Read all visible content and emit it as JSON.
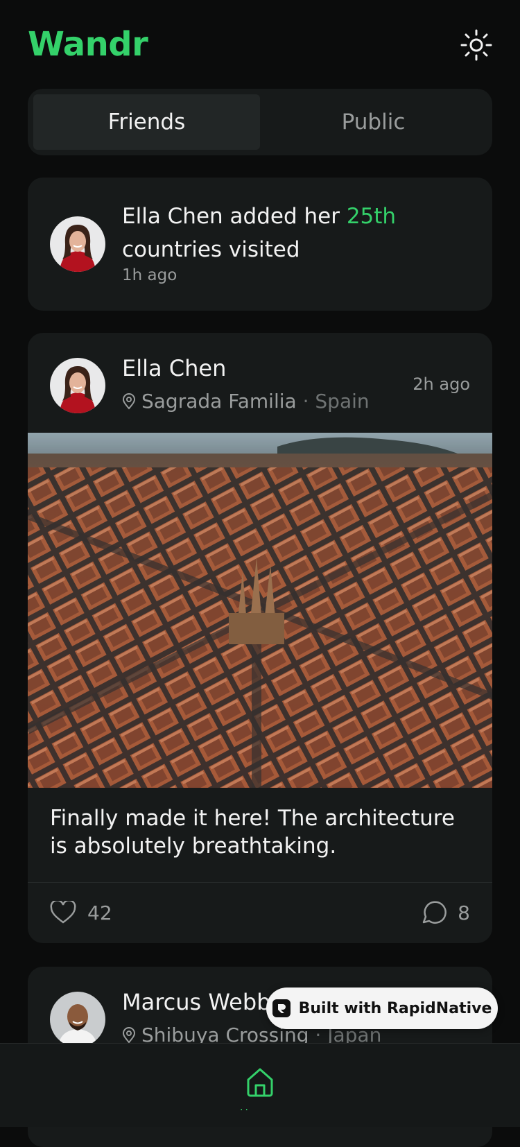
{
  "app": {
    "title": "Wandr",
    "accent_color": "#34d16a",
    "theme_icon": "sun-icon"
  },
  "tabs": [
    {
      "label": "Friends",
      "active": true
    },
    {
      "label": "Public",
      "active": false
    }
  ],
  "activity": {
    "text_before": "Ella Chen added her ",
    "highlight": "25th",
    "text_after": " countries visited",
    "time": "1h ago"
  },
  "post": {
    "author": "Ella Chen",
    "place": "Sagrada Familia",
    "separator": "·",
    "country": "Spain",
    "time": "2h ago",
    "caption": "Finally made it here! The architecture is absolutely breathtaking.",
    "likes": "42",
    "comments": "8",
    "icons": {
      "location": "location-pin-icon",
      "like": "heart-icon",
      "comment": "comment-bubble-icon"
    }
  },
  "post2": {
    "author": "Marcus Webb",
    "place": "Shibuya Crossing",
    "separator": "·",
    "country": "Japan"
  },
  "badge": {
    "label": "Built with RapidNative",
    "icon": "rapidnative-logo-icon"
  },
  "tabbar": {
    "active_tab": "home",
    "icon": "home-icon"
  }
}
